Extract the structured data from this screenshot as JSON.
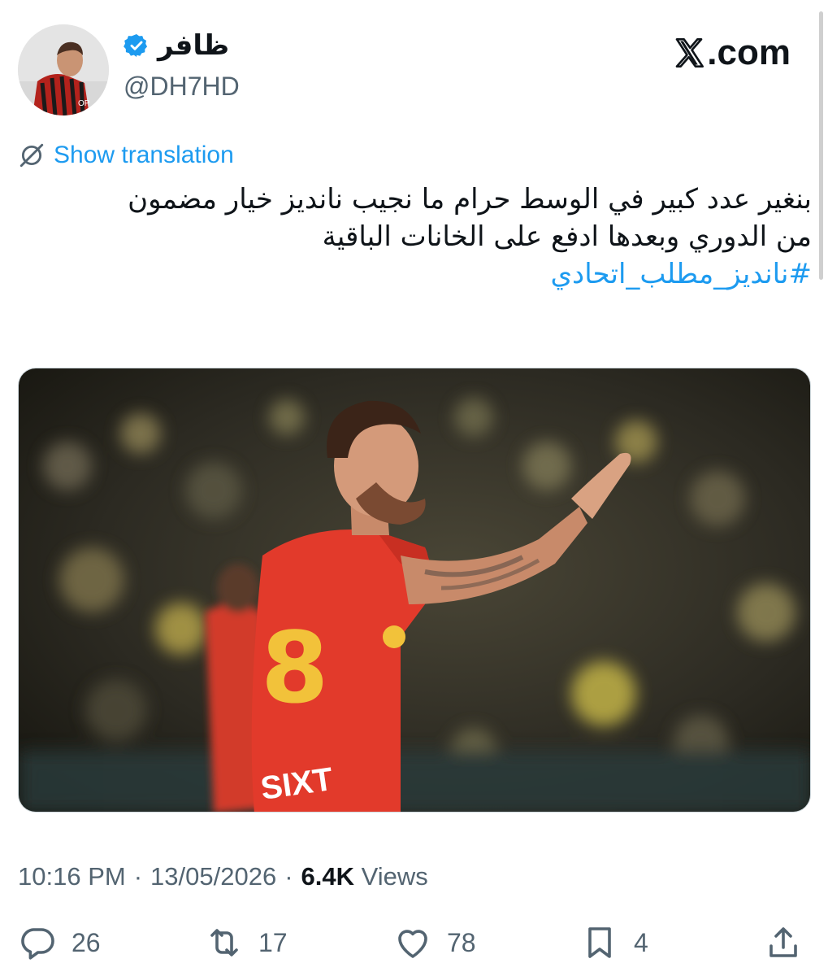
{
  "brand": {
    "logo_text": ".com"
  },
  "author": {
    "display_name": "ظافر",
    "handle": "@DH7HD",
    "verified": true
  },
  "translation": {
    "label": "Show translation"
  },
  "tweet": {
    "lines": [
      "بنغير عدد كبير في الوسط حرام ما نجيب نانديز خيار مضمون",
      "من الدوري وبعدها ادفع على الخانات الباقية"
    ],
    "hashtag": "#نانديز_مطلب_اتحادي"
  },
  "media": {
    "jersey_number": "8",
    "sponsor": "SIXT"
  },
  "meta": {
    "time": "10:16 PM",
    "separator": "·",
    "date": "13/05/2026",
    "views_count": "6.4K",
    "views_label": "Views"
  },
  "actions": {
    "reply": {
      "icon": "reply-icon",
      "count": "26"
    },
    "retweet": {
      "icon": "retweet-icon",
      "count": "17"
    },
    "like": {
      "icon": "heart-icon",
      "count": "78"
    },
    "bookmark": {
      "icon": "bookmark-icon",
      "count": "4"
    },
    "share": {
      "icon": "share-icon"
    }
  },
  "colors": {
    "accent": "#1d9bf0",
    "secondary_text": "#536471",
    "primary_text": "#0f1419",
    "jersey_red": "#e23a2b"
  }
}
